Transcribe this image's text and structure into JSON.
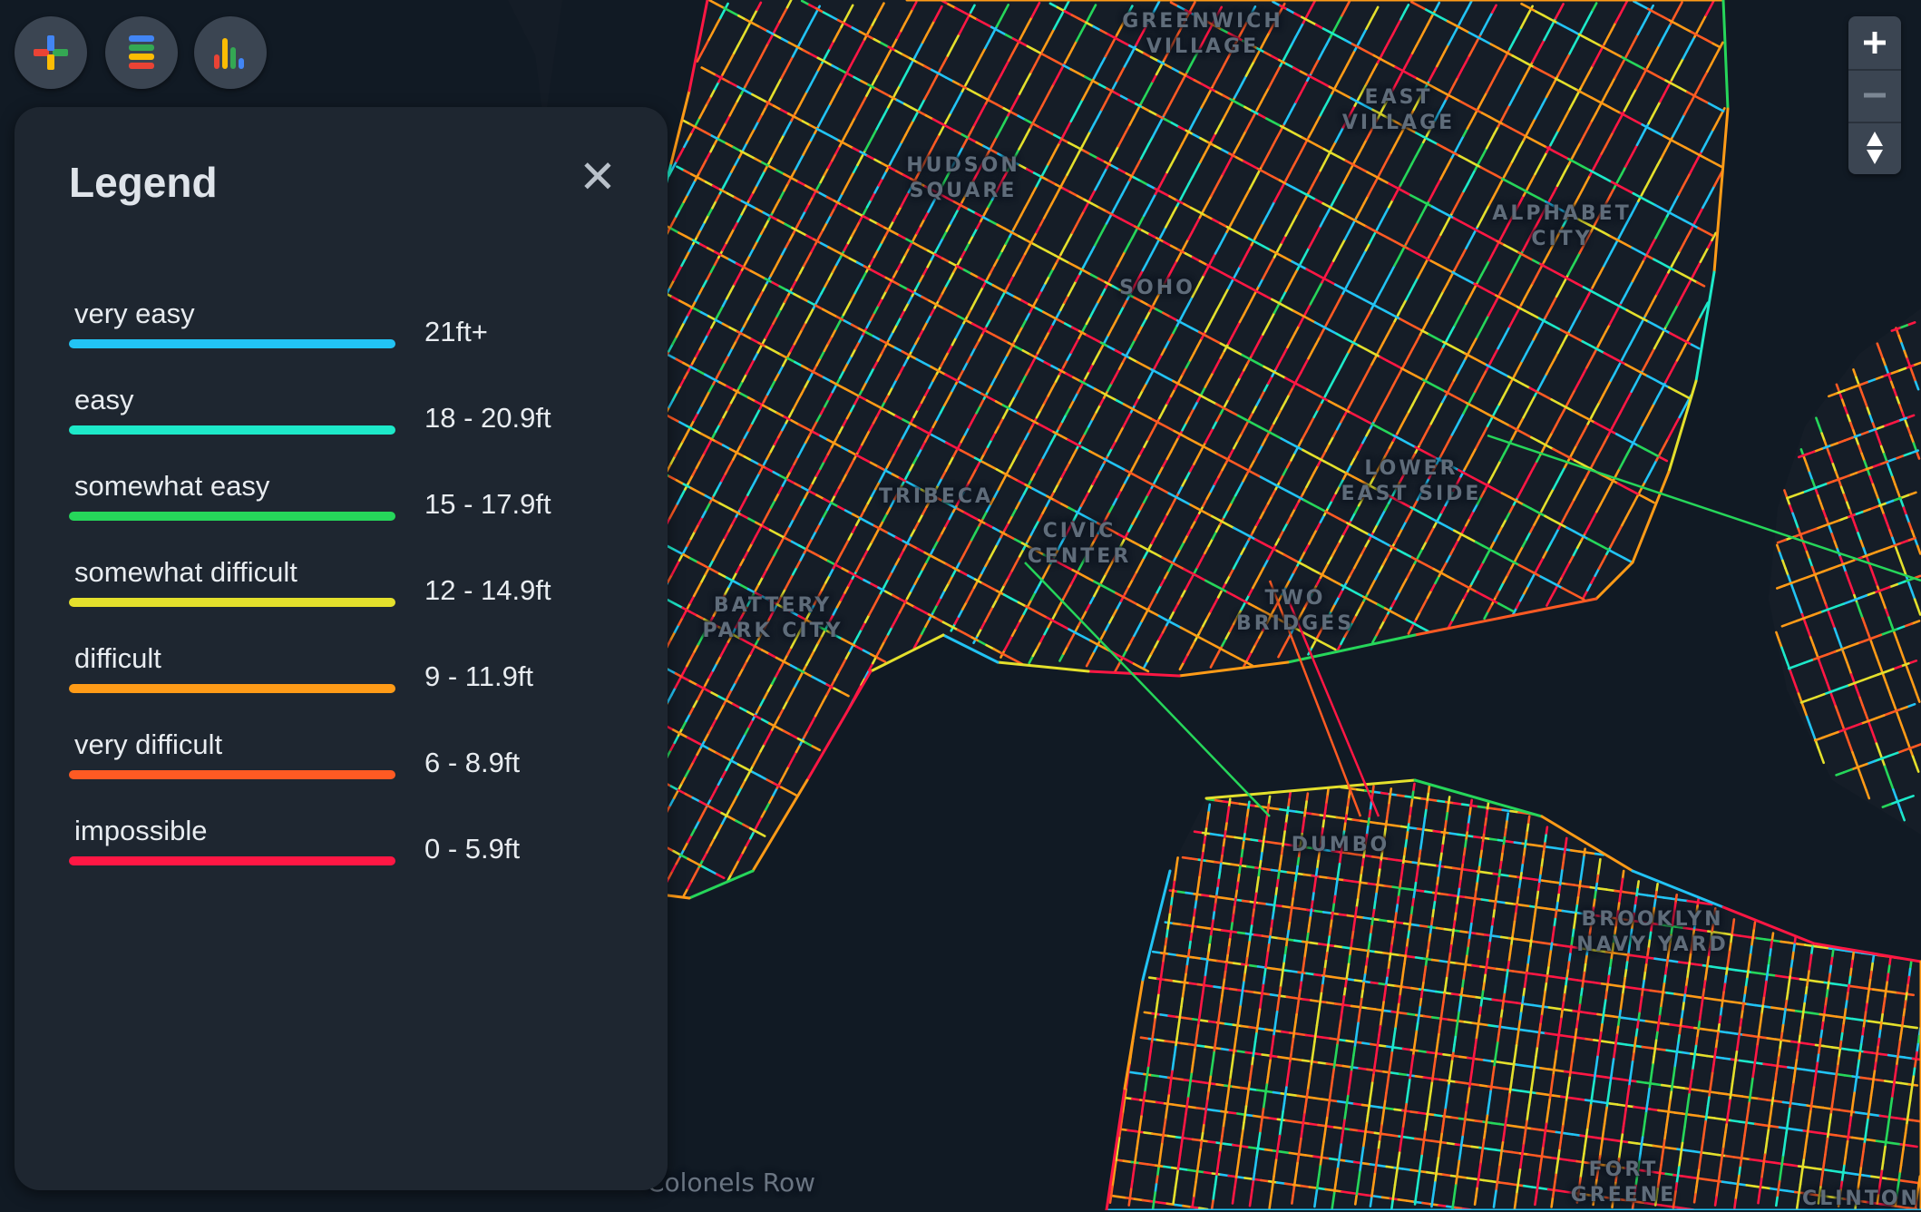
{
  "map": {
    "labels": [
      {
        "text": "GREENWICH\nVILLAGE"
      },
      {
        "text": "EAST\nVILLAGE"
      },
      {
        "text": "HUDSON\nSQUARE"
      },
      {
        "text": "ALPHABET\nCITY"
      },
      {
        "text": "SOHO"
      },
      {
        "text": "LOWER\nEAST SIDE"
      },
      {
        "text": "TRIBECA"
      },
      {
        "text": "CIVIC\nCENTER"
      },
      {
        "text": "BATTERY\nPARK CITY"
      },
      {
        "text": "TWO\nBRIDGES"
      },
      {
        "text": "DUMBO"
      },
      {
        "text": "BROOKLYN\nNAVY YARD"
      },
      {
        "text": "FORT\nGREENE"
      },
      {
        "text": "CLINTON"
      },
      {
        "text": "Colonels Row"
      }
    ]
  },
  "toolbar": {
    "buttons": [
      {
        "icon": "plus-icon"
      },
      {
        "icon": "list-icon"
      },
      {
        "icon": "bar-chart-icon"
      }
    ]
  },
  "legend": {
    "title": "Legend",
    "close_icon": "close-icon",
    "close_glyph": "✕",
    "items": [
      {
        "label": "very easy",
        "range": "21ft+",
        "color": "#22c3f4"
      },
      {
        "label": "easy",
        "range": "18 - 20.9ft",
        "color": "#1de9c9"
      },
      {
        "label": "somewhat easy",
        "range": "15 - 17.9ft",
        "color": "#26d65a"
      },
      {
        "label": "somewhat difficult",
        "range": "12 - 14.9ft",
        "color": "#e4e02c"
      },
      {
        "label": "difficult",
        "range": "9 - 11.9ft",
        "color": "#ff9b17"
      },
      {
        "label": "very difficult",
        "range": "6 - 8.9ft",
        "color": "#ff5a23"
      },
      {
        "label": "impossible",
        "range": "0 - 5.9ft",
        "color": "#ff1744"
      }
    ]
  },
  "zoom": {
    "zoom_in_icon": "plus-icon",
    "zoom_out_icon": "minus-icon",
    "compass_icon": "compass-icon"
  }
}
